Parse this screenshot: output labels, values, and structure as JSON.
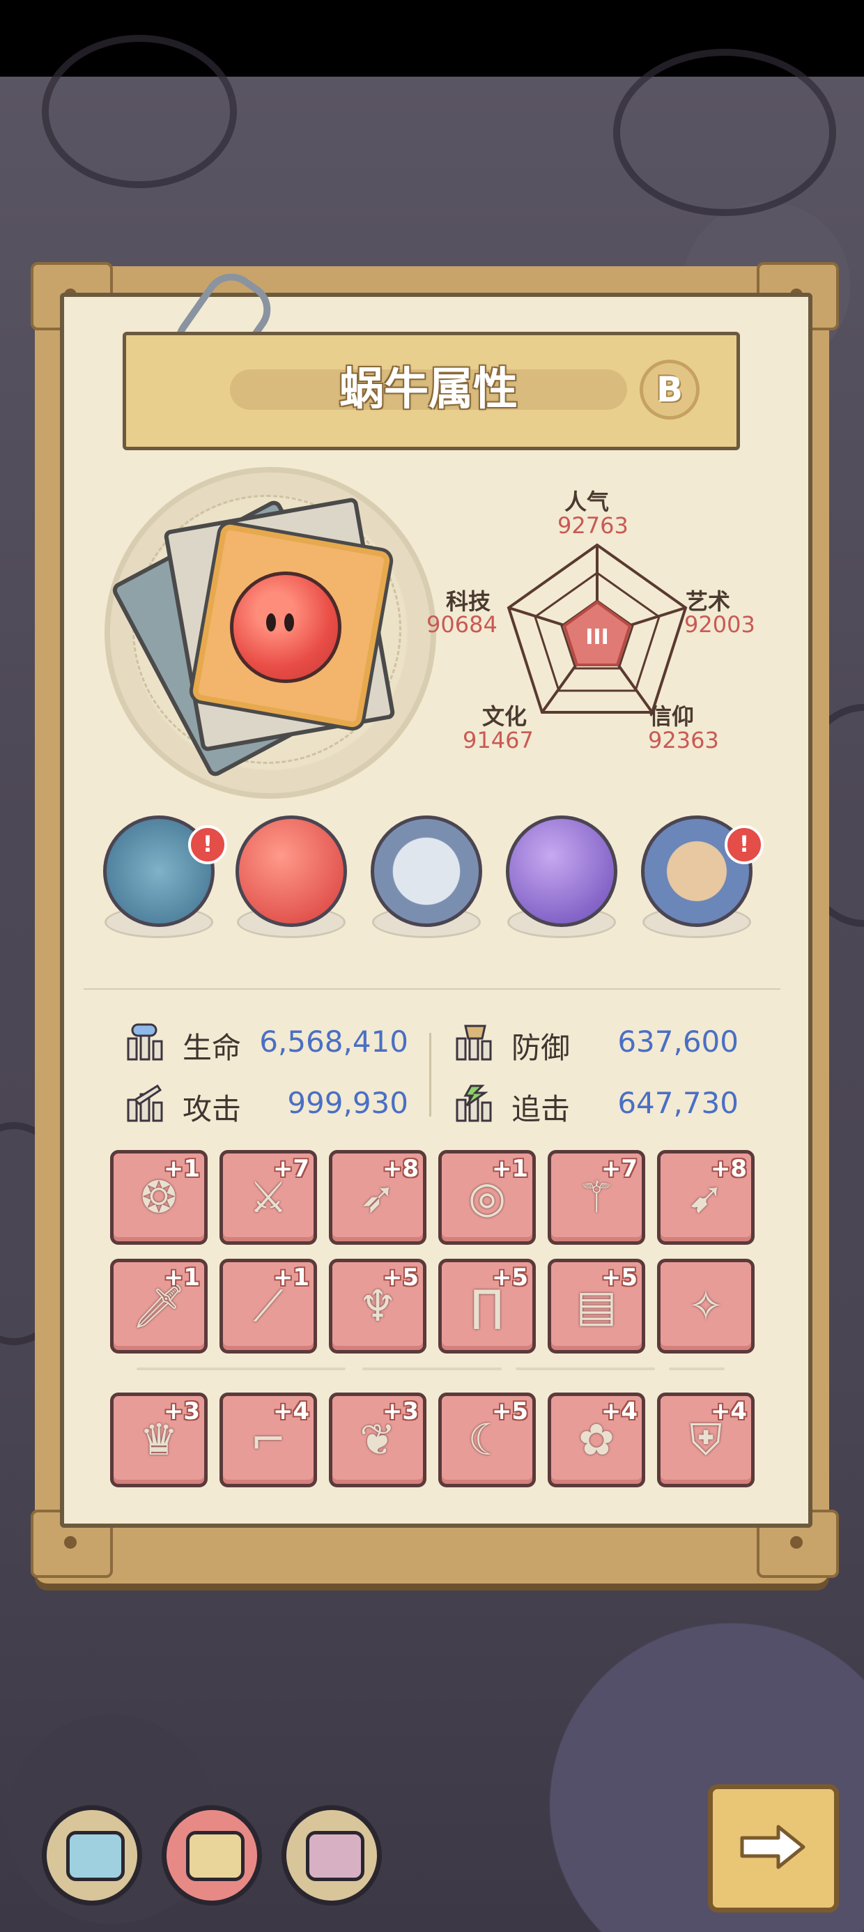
{
  "title": "蜗牛属性",
  "grade": "B",
  "radar": {
    "center_label": "III",
    "axes": [
      {
        "label": "人气",
        "value": "92763"
      },
      {
        "label": "艺术",
        "value": "92003"
      },
      {
        "label": "信仰",
        "value": "92363"
      },
      {
        "label": "文化",
        "value": "91467"
      },
      {
        "label": "科技",
        "value": "90684"
      }
    ]
  },
  "relics": [
    {
      "name": "monster-relic",
      "alert": true
    },
    {
      "name": "red-orb-relic",
      "alert": false
    },
    {
      "name": "compass-relic",
      "alert": false
    },
    {
      "name": "galaxy-orb-relic",
      "alert": false
    },
    {
      "name": "cube-relic",
      "alert": true
    }
  ],
  "alert_mark": "!",
  "stats": {
    "hp_label": "生命",
    "hp_value": "6,568,410",
    "def_label": "防御",
    "def_value": "637,600",
    "atk_label": "攻击",
    "atk_value": "999,930",
    "chase_label": "追击",
    "chase_value": "647,730"
  },
  "equipment_row1": [
    {
      "icon": "amulet-icon",
      "level": "+1"
    },
    {
      "icon": "sword-icon",
      "level": "+7"
    },
    {
      "icon": "crossbow-icon",
      "level": "+8"
    },
    {
      "icon": "ring-icon",
      "level": "+1"
    },
    {
      "icon": "staff-icon",
      "level": "+7"
    },
    {
      "icon": "rocket-icon",
      "level": "+8"
    }
  ],
  "equipment_row2": [
    {
      "icon": "dagger-icon",
      "level": "+1"
    },
    {
      "icon": "spear-icon",
      "level": "+1"
    },
    {
      "icon": "trident-icon",
      "level": "+5"
    },
    {
      "icon": "pants-icon",
      "level": "+5"
    },
    {
      "icon": "armor-icon",
      "level": "+5"
    },
    {
      "icon": "wand-icon",
      "level": ""
    }
  ],
  "equipment_row3": [
    {
      "icon": "mask-icon",
      "level": "+3"
    },
    {
      "icon": "boots-icon",
      "level": "+4"
    },
    {
      "icon": "wing-charm-icon",
      "level": "+3"
    },
    {
      "icon": "blade-icon",
      "level": "+5"
    },
    {
      "icon": "shield-icon",
      "level": "+4"
    },
    {
      "icon": "chestplate-icon",
      "level": "+4"
    }
  ],
  "bottom_nav": [
    {
      "icon": "brain-blue-icon",
      "active": false
    },
    {
      "icon": "brain-gold-icon",
      "active": true
    },
    {
      "icon": "brain-pink-icon",
      "active": false
    }
  ],
  "colors": {
    "accent_value": "#4a6fc4",
    "radar_value": "#c85a54",
    "equip_bg": "#e89c98"
  }
}
